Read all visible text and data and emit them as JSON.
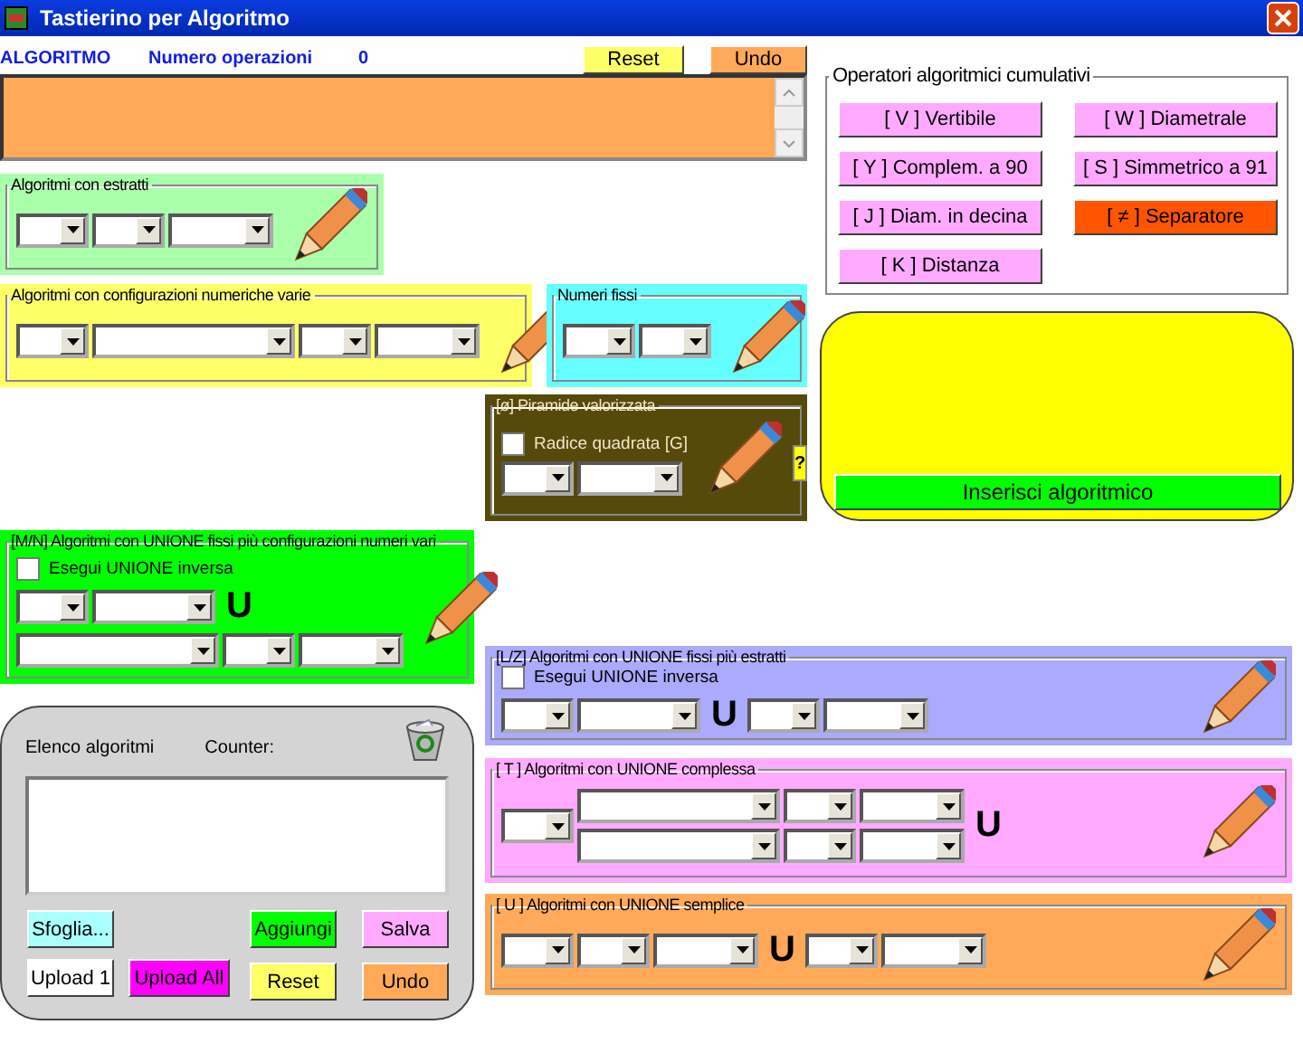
{
  "window": {
    "title": "Tastierino per Algoritmo"
  },
  "header": {
    "label": "ALGORITMO",
    "count_label": "Numero operazioni",
    "count": "0",
    "buttons": [
      {
        "label": "Reset",
        "color": "#ffff66"
      },
      {
        "label": "Undo",
        "color": "#ffa959"
      }
    ]
  },
  "algorithm_box": {
    "color": "#ffa959"
  },
  "operators": {
    "title": "Operatori algoritmici cumulativi",
    "buttons": [
      {
        "label": "[ V ] Vertibile",
        "color": "#ffaaff"
      },
      {
        "label": "[ W ] Diametrale",
        "color": "#ffaaff"
      },
      {
        "label": "[ Y ] Complem. a 90",
        "color": "#ffaaff"
      },
      {
        "label": "[ S ] Simmetrico  a 91",
        "color": "#ffaaff"
      },
      {
        "label": "[ J ] Diam. in decina",
        "color": "#ffaaff"
      },
      {
        "label": "[ ≠ ] Separatore",
        "color": "#ff5500"
      },
      {
        "label": "[ K ] Distanza",
        "color": "#ffaaff"
      }
    ]
  },
  "insert_panel": {
    "button": "Inserisci algoritmico"
  },
  "groups": [
    {
      "title": "Algoritmi con estratti",
      "color": "#aaffaa",
      "rows": [
        [
          {
            "kind": "narrow"
          },
          {
            "kind": "narrow"
          },
          {
            "kind": "medium"
          }
        ]
      ]
    },
    {
      "title": "Algoritmi con configurazioni numeriche varie",
      "color": "#ffff66",
      "rows": [
        [
          {
            "kind": "narrow"
          },
          {
            "kind": "wide"
          },
          {
            "kind": "narrow"
          },
          {
            "kind": "medium"
          }
        ]
      ]
    },
    {
      "title": "Numeri fissi",
      "color": "#66ffff",
      "rows": [
        [
          {
            "kind": "narrow"
          },
          {
            "kind": "narrow"
          }
        ]
      ]
    },
    {
      "title": "[ø] Piramide valorizzata",
      "color": "#554a0a",
      "checkbox": {
        "label": "Radice quadrata  [G]",
        "checked": false
      },
      "help": "?",
      "rows": [
        [
          {
            "kind": "narrow"
          },
          {
            "kind": "medium"
          }
        ]
      ]
    },
    {
      "title": "[M/N] Algoritmi con UNIONE fissi più configurazioni numeri vari",
      "color": "#00ff00",
      "checkbox": {
        "label": "Esegui UNIONE inversa",
        "checked": false
      },
      "rows": [
        [
          {
            "kind": "narrow"
          },
          {
            "kind": "large"
          },
          {
            "kind": "union",
            "text": "U"
          }
        ],
        [
          {
            "kind": "wide"
          },
          {
            "kind": "narrow"
          },
          {
            "kind": "medium"
          }
        ]
      ]
    },
    {
      "title": "[L/Z] Algoritmi con UNIONE fissi più estratti",
      "color": "#aaaaff",
      "checkbox": {
        "label": "Esegui UNIONE inversa",
        "checked": false
      },
      "rows": [
        [
          {
            "kind": "narrow"
          },
          {
            "kind": "large"
          },
          {
            "kind": "union",
            "text": "U"
          },
          {
            "kind": "narrow"
          },
          {
            "kind": "medium"
          }
        ]
      ]
    },
    {
      "title": "[ T ] Algoritmi con UNIONE complessa",
      "color": "#ffaaff",
      "rows": [
        [
          {
            "kind": "narrow"
          },
          {
            "kind": "stack",
            "rows": [
              [
                {
                  "kind": "wide"
                },
                {
                  "kind": "narrow"
                },
                {
                  "kind": "medium"
                }
              ],
              [
                {
                  "kind": "wide"
                },
                {
                  "kind": "narrow"
                },
                {
                  "kind": "medium"
                }
              ]
            ]
          },
          {
            "kind": "union",
            "text": "U"
          }
        ]
      ]
    },
    {
      "title": "[ U ] Algoritmi con UNIONE semplice",
      "color": "#ffa959",
      "rows": [
        [
          {
            "kind": "narrow"
          },
          {
            "kind": "narrow"
          },
          {
            "kind": "medium"
          },
          {
            "kind": "union",
            "text": "U"
          },
          {
            "kind": "narrow"
          },
          {
            "kind": "medium"
          }
        ]
      ]
    }
  ],
  "list_panel": {
    "title": "Elenco algoritmi",
    "counter_label": "Counter:",
    "buttons": [
      {
        "label": "Sfoglia...",
        "color": "#aaffff"
      },
      {
        "label": "Aggiungi",
        "color": "#00ff00"
      },
      {
        "label": "Salva",
        "color": "#ffaaff"
      },
      {
        "label": "Upload 1",
        "color": "#ffffff"
      },
      {
        "label": "Upload All",
        "color": "#ff00ff"
      },
      {
        "label": "Reset",
        "color": "#ffff66"
      },
      {
        "label": "Undo",
        "color": "#ffa959"
      }
    ]
  }
}
